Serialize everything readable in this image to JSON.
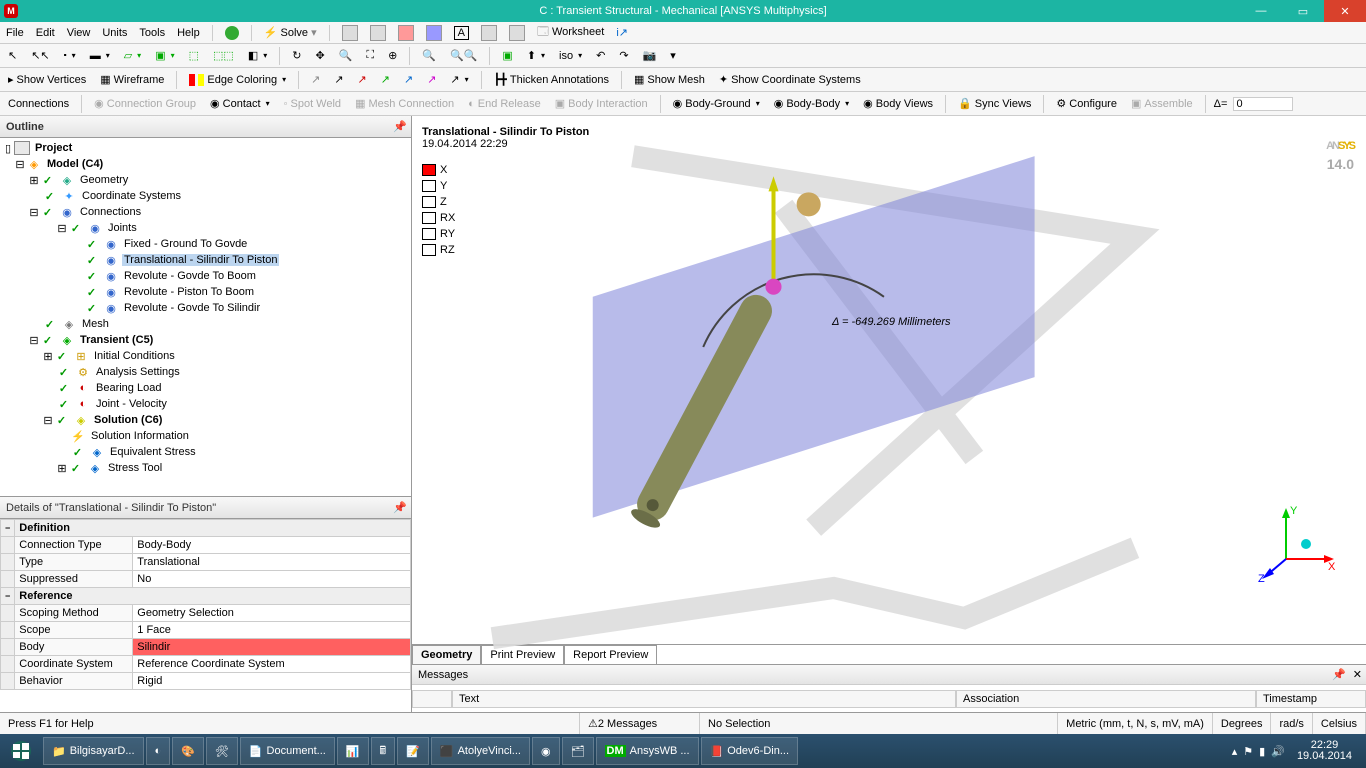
{
  "window": {
    "title": "C : Transient Structural - Mechanical [ANSYS Multiphysics]"
  },
  "menu": {
    "items": [
      "File",
      "Edit",
      "View",
      "Units",
      "Tools",
      "Help"
    ],
    "solve": "Solve",
    "worksheet": "Worksheet"
  },
  "toolbar2": {
    "show_vertices": "Show Vertices",
    "wireframe": "Wireframe",
    "edge_coloring": "Edge Coloring",
    "thicken": "Thicken Annotations",
    "show_mesh": "Show Mesh",
    "show_cs": "Show Coordinate Systems"
  },
  "toolbar3": {
    "connections": "Connections",
    "conn_group": "Connection Group",
    "contact": "Contact",
    "spot_weld": "Spot Weld",
    "mesh_conn": "Mesh Connection",
    "end_release": "End Release",
    "body_interaction": "Body Interaction",
    "body_ground": "Body-Ground",
    "body_body": "Body-Body",
    "body_views": "Body Views",
    "sync_views": "Sync Views",
    "configure": "Configure",
    "assemble": "Assemble",
    "delta_label": "Δ=",
    "delta_value": "0"
  },
  "outline": {
    "title": "Outline",
    "root": "Project",
    "model": "Model (C4)",
    "geometry": "Geometry",
    "coord_sys": "Coordinate Systems",
    "connections": "Connections",
    "joints": "Joints",
    "joint_list": [
      "Fixed - Ground To Govde",
      "Translational - Silindir To Piston",
      "Revolute - Govde To Boom",
      "Revolute - Piston To Boom",
      "Revolute - Govde To Silindir"
    ],
    "mesh": "Mesh",
    "transient": "Transient (C5)",
    "initial": "Initial Conditions",
    "analysis": "Analysis Settings",
    "bearing": "Bearing Load",
    "jointvel": "Joint - Velocity",
    "solution": "Solution (C6)",
    "solinfo": "Solution Information",
    "eqstress": "Equivalent Stress",
    "stresstool": "Stress Tool"
  },
  "details": {
    "title": "Details of \"Translational - Silindir To Piston\"",
    "sec_def": "Definition",
    "conn_type_k": "Connection Type",
    "conn_type_v": "Body-Body",
    "type_k": "Type",
    "type_v": "Translational",
    "supp_k": "Suppressed",
    "supp_v": "No",
    "sec_ref": "Reference",
    "scop_k": "Scoping Method",
    "scop_v": "Geometry Selection",
    "scope_k": "Scope",
    "scope_v": "1 Face",
    "body_k": "Body",
    "body_v": "Silindir",
    "cs_k": "Coordinate System",
    "cs_v": "Reference Coordinate System",
    "beh_k": "Behavior",
    "beh_v": "Rigid"
  },
  "view": {
    "title": "Translational - Silindir To Piston",
    "timestamp": "19.04.2014 22:29",
    "legend": [
      "X",
      "Y",
      "Z",
      "RX",
      "RY",
      "RZ"
    ],
    "delta": "Δ = -649.269 Millimeters",
    "logo_ver": "14.0",
    "tabs": [
      "Geometry",
      "Print Preview",
      "Report Preview"
    ],
    "triad": {
      "x": "X",
      "y": "Y",
      "z": "Z"
    }
  },
  "messages": {
    "title": "Messages",
    "cols": [
      "Text",
      "Association",
      "Timestamp"
    ]
  },
  "status": {
    "help": "Press F1 for Help",
    "msg": "2 Messages",
    "sel": "No Selection",
    "units": "Metric (mm, t, N, s, mV, mA)",
    "deg": "Degrees",
    "rads": "rad/s",
    "cel": "Celsius"
  },
  "taskbar": {
    "items": [
      "BilgisayarD...",
      "",
      "",
      "",
      "",
      "Document...",
      "",
      "",
      "",
      "AtolyeVinci...",
      "",
      "",
      "AnsysWB ...",
      "Odev6-Din..."
    ],
    "time": "22:29",
    "date": "19.04.2014"
  }
}
